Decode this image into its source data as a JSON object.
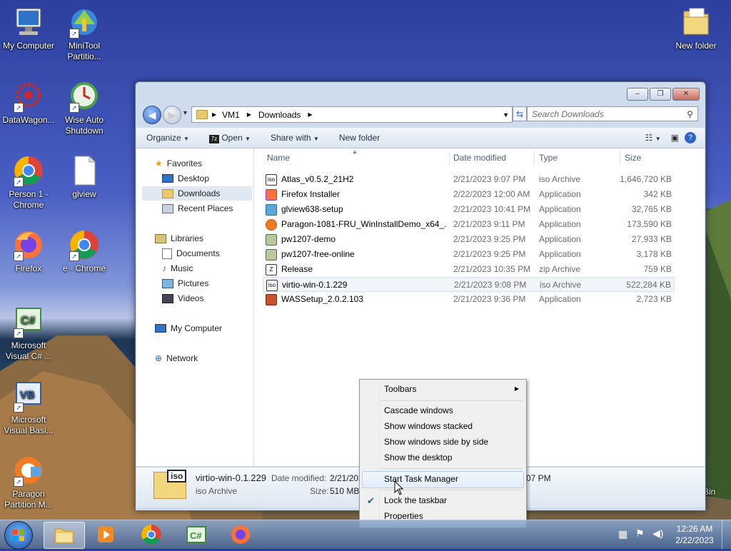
{
  "desktop": {
    "icons": [
      {
        "label": "My Computer",
        "icon": "computer-icon"
      },
      {
        "label": "MiniTool Partitio...",
        "icon": "minitool-icon"
      },
      {
        "label": "DataWagon...",
        "icon": "datawagon-icon"
      },
      {
        "label": "Wise Auto Shutdown",
        "icon": "wise-shutdown-icon"
      },
      {
        "label": "Person 1 - Chrome",
        "icon": "chrome-icon"
      },
      {
        "label": "glview",
        "icon": "document-icon"
      },
      {
        "label": "Firefox",
        "icon": "firefox-icon"
      },
      {
        "label": "e - Chrome",
        "icon": "chrome-icon"
      },
      {
        "label": "Microsoft Visual C# ...",
        "icon": "visual-csharp-icon"
      },
      {
        "label": "Microsoft Visual Basi...",
        "icon": "visual-basic-icon"
      },
      {
        "label": "Paragon Partition M...",
        "icon": "paragon-icon"
      },
      {
        "label": "New folder",
        "icon": "folder-icon"
      },
      {
        "label": "Bin",
        "icon": "recycle-bin-icon"
      }
    ]
  },
  "explorer": {
    "caption_buttons": [
      "–",
      "❐",
      "✕"
    ],
    "breadcrumb": [
      "VM1",
      "Downloads"
    ],
    "search_placeholder": "Search Downloads",
    "toolbar": {
      "organize": "Organize",
      "open": "Open",
      "share": "Share with",
      "new_folder": "New folder"
    },
    "nav": {
      "favorites": "Favorites",
      "desktop": "Desktop",
      "downloads": "Downloads",
      "recent": "Recent Places",
      "libraries": "Libraries",
      "documents": "Documents",
      "music": "Music",
      "pictures": "Pictures",
      "videos": "Videos",
      "computer": "My Computer",
      "network": "Network"
    },
    "columns": {
      "name": "Name",
      "date": "Date modified",
      "type": "Type",
      "size": "Size"
    },
    "files": [
      {
        "name": "Atlas_v0.5.2_21H2",
        "date": "2/21/2023 9:07 PM",
        "type": "iso Archive",
        "size": "1,646,720 KB"
      },
      {
        "name": "Firefox Installer",
        "date": "2/22/2023 12:00 AM",
        "type": "Application",
        "size": "342 KB"
      },
      {
        "name": "glview638-setup",
        "date": "2/21/2023 10:41 PM",
        "type": "Application",
        "size": "32,765 KB"
      },
      {
        "name": "Paragon-1081-FRU_WinInstallDemo_x64_...",
        "date": "2/21/2023 9:11 PM",
        "type": "Application",
        "size": "173,590 KB"
      },
      {
        "name": "pw1207-demo",
        "date": "2/21/2023 9:25 PM",
        "type": "Application",
        "size": "27,933 KB"
      },
      {
        "name": "pw1207-free-online",
        "date": "2/21/2023 9:25 PM",
        "type": "Application",
        "size": "3,178 KB"
      },
      {
        "name": "Release",
        "date": "2/21/2023 10:35 PM",
        "type": "zip Archive",
        "size": "759 KB"
      },
      {
        "name": "virtio-win-0.1.229",
        "date": "2/21/2023 9:08 PM",
        "type": "iso Archive",
        "size": "522,284 KB"
      },
      {
        "name": "WASSetup_2.0.2.103",
        "date": "2/21/2023 9:36 PM",
        "type": "Application",
        "size": "2,723 KB"
      }
    ],
    "details": {
      "icon_text": "iso",
      "name": "virtio-win-0.1.229",
      "type": "iso Archive",
      "date_label": "Date modified:",
      "date_value": "2/21/202",
      "date_tail": "07 PM",
      "size_label": "Size:",
      "size_value": "510 MB"
    }
  },
  "context_menu": {
    "items": [
      "Toolbars",
      "Cascade windows",
      "Show windows stacked",
      "Show windows side by side",
      "Show the desktop",
      "Start Task Manager",
      "Lock the taskbar",
      "Properties"
    ]
  },
  "taskbar": {
    "apps": [
      "windows-explorer",
      "media-player",
      "chrome",
      "visual-csharp",
      "firefox"
    ],
    "clock": {
      "time": "12:26 AM",
      "date": "2/22/2023"
    }
  },
  "colors": {
    "accent": "#3399ff",
    "selection": "#dfe8f3",
    "menu_hover": "#e5eefa"
  }
}
